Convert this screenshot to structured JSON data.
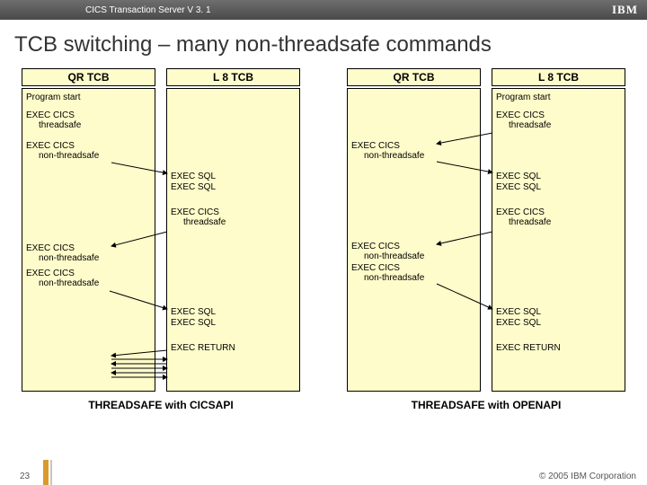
{
  "top": {
    "product": "CICS Transaction Server V 3. 1",
    "brand": "IBM"
  },
  "title": "TCB switching – many non-threadsafe commands",
  "headers": {
    "qr": "QR TCB",
    "l8": "L 8 TCB"
  },
  "caption_left": "THREADSAFE with CICSAPI",
  "caption_right": "THREADSAFE with OPENAPI",
  "footer": {
    "page": "23",
    "copyright": "© 2005 IBM Corporation"
  },
  "labels": {
    "program_start": "Program start",
    "exec_cics": "EXEC CICS",
    "threadsafe": "threadsafe",
    "non_threadsafe": "non-threadsafe",
    "exec_sql": "EXEC SQL",
    "exec_return": "EXEC RETURN"
  }
}
